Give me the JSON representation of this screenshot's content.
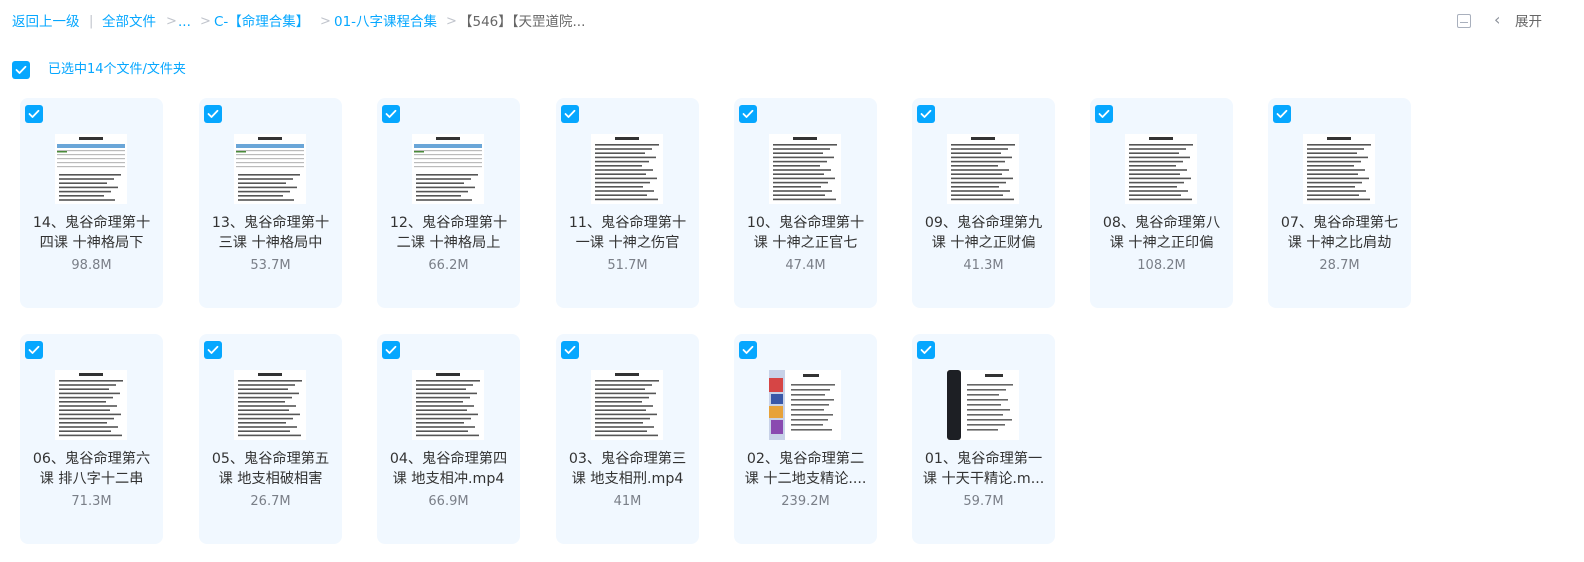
{
  "breadcrumb": {
    "back": "返回上一级",
    "sep1": "|",
    "all_files": "全部文件",
    "sep2": ">",
    "ellipsis": "...",
    "sep3": ">",
    "c_folder": "C-【命理合集】",
    "sep4": ">",
    "bazi_folder": "01-八字课程合集",
    "sep5": ">",
    "current": "【546】【天罡道院..."
  },
  "toolbar": {
    "list_view_icon": "list-view-icon",
    "chevron": "‹",
    "expand_label": "展开"
  },
  "selection": {
    "text": "已选中14个文件/文件夹",
    "checked": true
  },
  "colors": {
    "accent": "#06a7ff",
    "card_bg": "#f1f8ff",
    "name_text": "#333333",
    "size_text": "#7a7f88"
  },
  "files": [
    {
      "name": "14、鬼谷命理第十四课 十神格局下",
      "size": "98.8M",
      "thumb": "table-doc"
    },
    {
      "name": "13、鬼谷命理第十三课 十神格局中",
      "size": "53.7M",
      "thumb": "table-doc"
    },
    {
      "name": "12、鬼谷命理第十二课 十神格局上",
      "size": "66.2M",
      "thumb": "table-doc"
    },
    {
      "name": "11、鬼谷命理第十一课 十神之伤官",
      "size": "51.7M",
      "thumb": "text-doc"
    },
    {
      "name": "10、鬼谷命理第十课 十神之正官七",
      "size": "47.4M",
      "thumb": "text-doc"
    },
    {
      "name": "09、鬼谷命理第九课 十神之正财偏",
      "size": "41.3M",
      "thumb": "text-doc"
    },
    {
      "name": "08、鬼谷命理第八课 十神之正印偏",
      "size": "108.2M",
      "thumb": "text-doc"
    },
    {
      "name": "07、鬼谷命理第七课 十神之比肩劫",
      "size": "28.7M",
      "thumb": "text-doc"
    },
    {
      "name": "06、鬼谷命理第六课 排八字十二串",
      "size": "71.3M",
      "thumb": "text-doc"
    },
    {
      "name": "05、鬼谷命理第五课 地支相破相害",
      "size": "26.7M",
      "thumb": "text-doc"
    },
    {
      "name": "04、鬼谷命理第四课 地支相冲.mp4",
      "size": "66.9M",
      "thumb": "text-doc"
    },
    {
      "name": "03、鬼谷命理第三课 地支相刑.mp4",
      "size": "41M",
      "thumb": "text-doc"
    },
    {
      "name": "02、鬼谷命理第二课 十二地支精论....",
      "size": "239.2M",
      "thumb": "art-doc"
    },
    {
      "name": "01、鬼谷命理第一课 十天干精论.m...",
      "size": "59.7M",
      "thumb": "dark-doc"
    }
  ]
}
